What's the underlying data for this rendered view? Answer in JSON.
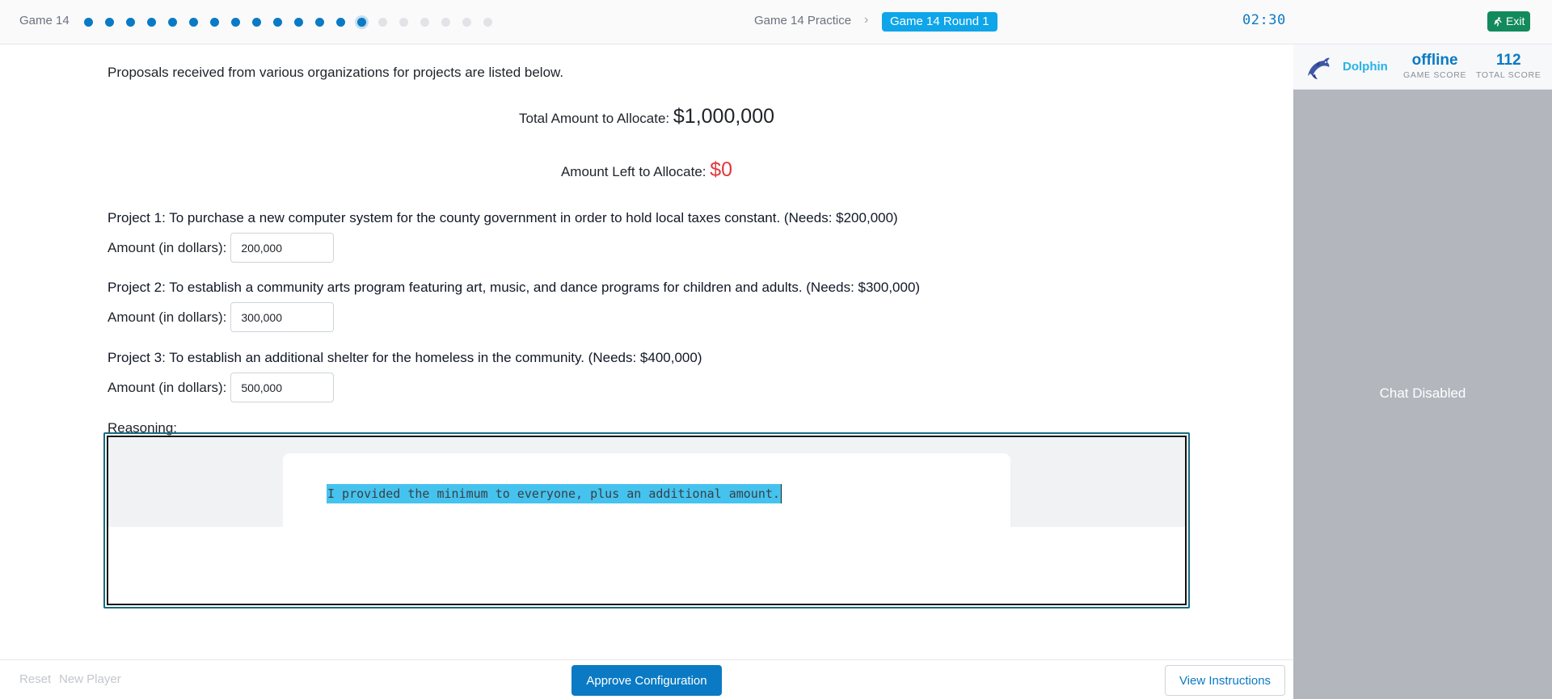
{
  "header": {
    "game_name": "Game 14",
    "progress": {
      "completed": 13,
      "current_index": 13,
      "total": 20
    },
    "breadcrumb_practice": "Game 14 Practice",
    "breadcrumb_current": "Game 14 Round 1",
    "timer": "02:30",
    "exit_label": "Exit"
  },
  "main": {
    "intro": "Proposals received from various organizations for projects are listed below.",
    "total_label": "Total Amount to Allocate:",
    "total_value": "$1,000,000",
    "left_label": "Amount Left to Allocate:",
    "left_value": "$0",
    "amount_label": "Amount (in dollars):",
    "projects": [
      {
        "title": "Project 1: To purchase a new computer system for the county government in order to hold local taxes constant. (Needs: $200,000)",
        "amount": "200,000"
      },
      {
        "title": "Project 2: To establish a community arts program featuring art, music, and dance programs for children and adults. (Needs: $300,000)",
        "amount": "300,000"
      },
      {
        "title": "Project 3: To establish an additional shelter for the homeless in the community. (Needs: $400,000)",
        "amount": "500,000"
      }
    ],
    "reasoning_label": "Reasoning:",
    "reasoning_text": "I provided the minimum to everyone, plus an additional amount."
  },
  "footer": {
    "reset_label": "Reset",
    "new_player_label": "New Player",
    "approve_label": "Approve Configuration",
    "instructions_label": "View Instructions"
  },
  "side": {
    "player_name": "Dolphin",
    "avatar_icon": "dolphin-icon",
    "game_score_value": "offline",
    "game_score_label": "GAME SCORE",
    "total_score_value": "112",
    "total_score_label": "TOTAL SCORE",
    "chat_status": "Chat Disabled"
  },
  "colors": {
    "accent": "#0a7ac4",
    "badge": "#0ea5e9",
    "exit": "#128a5c",
    "alert": "#e0383e",
    "highlight": "#45c3ef"
  }
}
